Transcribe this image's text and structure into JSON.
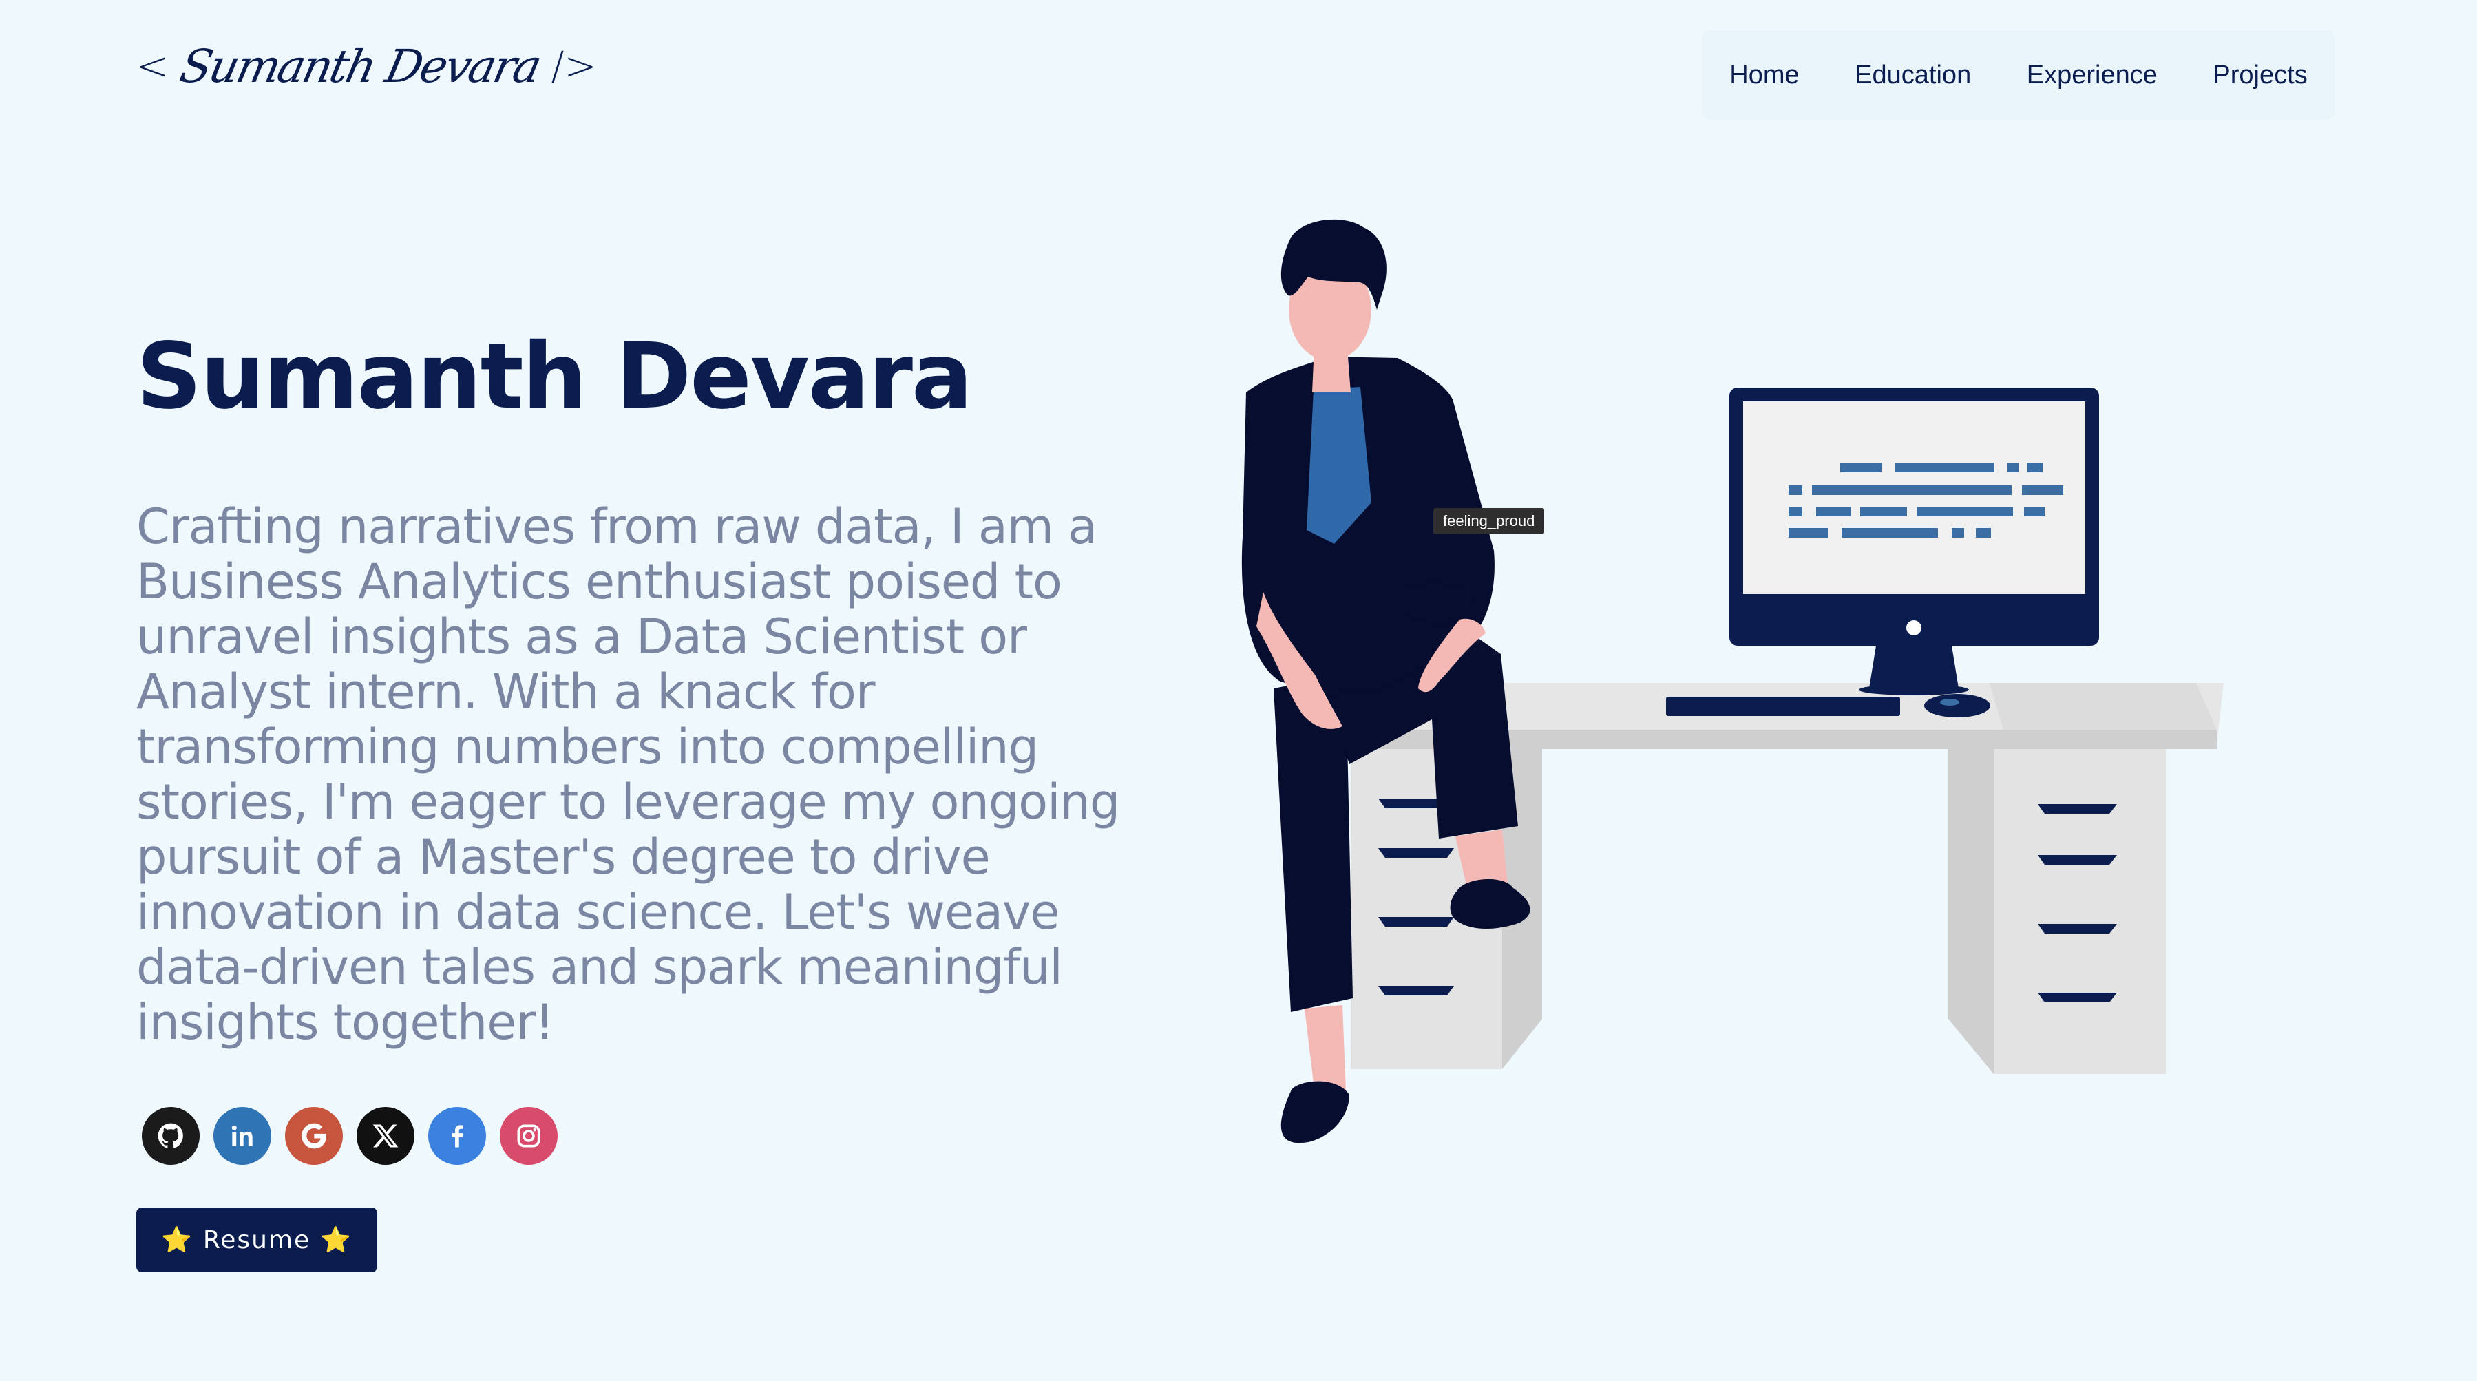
{
  "logo": {
    "open": "<",
    "signature": "Sumanth Devara",
    "close": "/>"
  },
  "nav": {
    "items": [
      {
        "label": "Home"
      },
      {
        "label": "Education"
      },
      {
        "label": "Experience"
      },
      {
        "label": "Projects"
      }
    ]
  },
  "hero": {
    "name": "Sumanth Devara",
    "bio": "Crafting narratives from raw data, I am a Business Analytics enthusiast poised to unravel insights as a Data Scientist or Analyst intern. With a knack for transforming numbers into compelling stories, I'm eager to leverage my ongoing pursuit of a Master's degree to drive innovation in data science. Let's weave data-driven tales and spark meaningful insights together!"
  },
  "socials": [
    {
      "icon": "github-icon",
      "color": "#1b1b1b"
    },
    {
      "icon": "linkedin-icon",
      "color": "#2f74b5"
    },
    {
      "icon": "google-icon",
      "color": "#c8553d"
    },
    {
      "icon": "x-icon",
      "color": "#111111"
    },
    {
      "icon": "facebook-icon",
      "color": "#3b82e0"
    },
    {
      "icon": "instagram-icon",
      "color": "#d94b6a"
    }
  ],
  "resume": {
    "star": "⭐",
    "label": "Resume"
  },
  "illustration": {
    "tooltip": "feeling_proud"
  },
  "colors": {
    "background": "#eef8fd",
    "primary": "#0b1d4e",
    "text_muted": "#7b86a3",
    "accent_blue": "#3a6ea5"
  }
}
